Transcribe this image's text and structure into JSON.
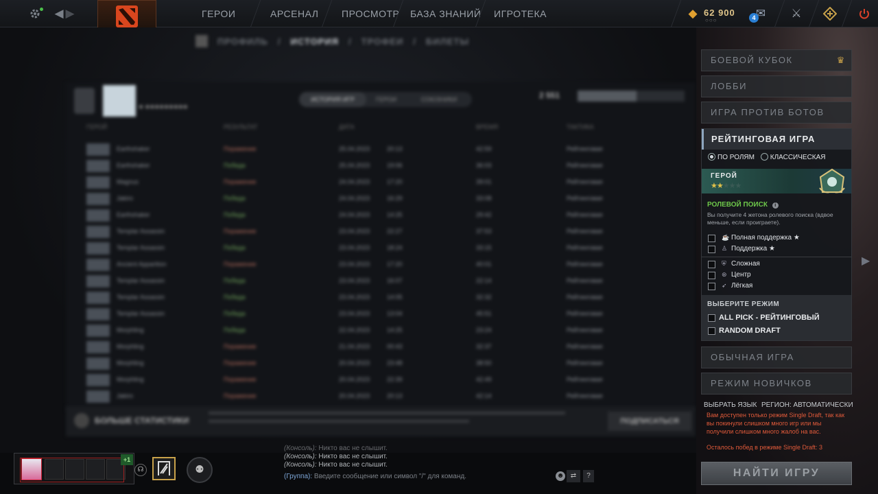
{
  "topbar": {
    "nav": [
      "ГЕРОИ",
      "АРСЕНАЛ",
      "ПРОСМОТР",
      "БАЗА ЗНАНИЙ",
      "ИГРОТЕКА"
    ],
    "gold": "62 900",
    "notifications": "4",
    "icons": [
      "gear-icon",
      "back-arrow-icon",
      "forward-arrow-icon",
      "dota-logo-icon",
      "mail-icon",
      "armory-icon",
      "plus-icon",
      "power-icon"
    ]
  },
  "profile_tabs": [
    "ПРОФИЛЬ",
    "ИСТОРИЯ",
    "ТРОФЕИ",
    "БИЛЕТЫ"
  ],
  "history": {
    "subtabs": [
      "ИСТОРИЯ ИГР",
      "ГЕРОИ",
      "СОЮЗНИКИ"
    ],
    "columns": [
      "ГЕРОЙ",
      "РЕЗУЛЬТАТ",
      "ДАТА",
      "ВРЕМЯ",
      "ТАКТИКА"
    ],
    "rows": [
      {
        "hero": "Earthshaker",
        "result": "Поражение",
        "date": "25.04.2023",
        "time": "20:13",
        "duration": "42:59",
        "mode": "Рейтинговая"
      },
      {
        "hero": "Earthshaker",
        "result": "Победа",
        "date": "25.04.2023",
        "time": "19:06",
        "duration": "36:03",
        "mode": "Рейтинговая"
      },
      {
        "hero": "Magnus",
        "result": "Поражение",
        "date": "24.04.2023",
        "time": "17:20",
        "duration": "39:01",
        "mode": "Рейтинговая"
      },
      {
        "hero": "Jakiro",
        "result": "Победа",
        "date": "24.04.2023",
        "time": "16:29",
        "duration": "33:08",
        "mode": "Рейтинговая"
      },
      {
        "hero": "Earthshaker",
        "result": "Победа",
        "date": "24.04.2023",
        "time": "14:25",
        "duration": "29:42",
        "mode": "Рейтинговая"
      },
      {
        "hero": "Templar Assassin",
        "result": "Поражение",
        "date": "23.04.2023",
        "time": "22:27",
        "duration": "37:53",
        "mode": "Рейтинговая"
      },
      {
        "hero": "Templar Assassin",
        "result": "Победа",
        "date": "23.04.2023",
        "time": "18:24",
        "duration": "33:15",
        "mode": "Рейтинговая"
      },
      {
        "hero": "Ancient Apparition",
        "result": "Поражение",
        "date": "23.04.2023",
        "time": "17:20",
        "duration": "40:01",
        "mode": "Рейтинговая"
      },
      {
        "hero": "Templar Assassin",
        "result": "Победа",
        "date": "23.04.2023",
        "time": "16:07",
        "duration": "22:14",
        "mode": "Рейтинговая"
      },
      {
        "hero": "Templar Assassin",
        "result": "Победа",
        "date": "23.04.2023",
        "time": "14:05",
        "duration": "32:32",
        "mode": "Рейтинговая"
      },
      {
        "hero": "Templar Assassin",
        "result": "Победа",
        "date": "23.04.2023",
        "time": "13:04",
        "duration": "45:51",
        "mode": "Рейтинговая"
      },
      {
        "hero": "Morphling",
        "result": "Победа",
        "date": "22.04.2023",
        "time": "14:25",
        "duration": "23:24",
        "mode": "Рейтинговая"
      },
      {
        "hero": "Morphling",
        "result": "Поражение",
        "date": "21.04.2023",
        "time": "00:43",
        "duration": "32:37",
        "mode": "Рейтинговая"
      },
      {
        "hero": "Morphling",
        "result": "Поражение",
        "date": "20.04.2023",
        "time": "23:48",
        "duration": "38:50",
        "mode": "Рейтинговая"
      },
      {
        "hero": "Morphling",
        "result": "Поражение",
        "date": "20.04.2023",
        "time": "22:39",
        "duration": "42:49",
        "mode": "Рейтинговая"
      },
      {
        "hero": "Jakiro",
        "result": "Поражение",
        "date": "20.04.2023",
        "time": "20:13",
        "duration": "42:14",
        "mode": "Рейтинговая"
      }
    ],
    "more_stats": "БОЛЬШЕ СТАТИСТИКИ",
    "subscribe": "ПОДПИСАТЬСЯ"
  },
  "modes": {
    "battle_cup": "БОЕВОЙ КУБОК",
    "lobby": "ЛОББИ",
    "bots": "ИГРА ПРОТИВ БОТОВ",
    "rated": "РЕЙТИНГОВАЯ ИГРА",
    "radio_roles": "ПО РОЛЯМ",
    "radio_classic": "КЛАССИЧЕСКАЯ",
    "rank_name": "ГЕРОЙ",
    "rank_stars": 2,
    "rank_stars_max": 5,
    "role_search_title": "РОЛЕВОЙ ПОИСК",
    "role_search_desc": "Вы получите 4 жетона ролевого поиска (вдвое меньше, если проиграете).",
    "roles": [
      {
        "label": "Полная поддержка",
        "star": true
      },
      {
        "label": "Поддержка",
        "star": true
      },
      {
        "label": "Сложная",
        "star": false
      },
      {
        "label": "Центр",
        "star": false
      },
      {
        "label": "Лёгкая",
        "star": false
      }
    ],
    "choose_mode": "ВЫБЕРИТЕ РЕЖИМ",
    "submodes": [
      "ALL PICK - РЕЙТИНГОВЫЙ",
      "RANDOM DRAFT"
    ],
    "normal": "ОБЫЧНАЯ ИГРА",
    "newbie": "РЕЖИМ НОВИЧКОВ"
  },
  "footer": {
    "language": "ВЫБРАТЬ ЯЗЫК",
    "region": "РЕГИОН: АВТОМАТИЧЕСКИ",
    "warning": "Вам доступен только режим Single Draft, так как вы покинули слишком много игр или мы получили слишком много жалоб на вас.",
    "wins_left": "Осталось побед в режиме Single Draft: 3",
    "find_game": "НАЙТИ ИГРУ"
  },
  "chat": {
    "prefix": "(Консоль):",
    "lines": [
      "Никто вас не слышит.",
      "Никто вас не слышит.",
      "Никто вас не слышит."
    ],
    "group": "(Группа):",
    "placeholder": "Введите сообщение или символ \"/\" для команд."
  },
  "party": {
    "plus": "+1"
  },
  "colors": {
    "accent": "#8ea6bf",
    "win": "#6fa35a",
    "loss": "#b06a5a",
    "warning": "#e05a3a",
    "gold": "#e0c58a"
  }
}
